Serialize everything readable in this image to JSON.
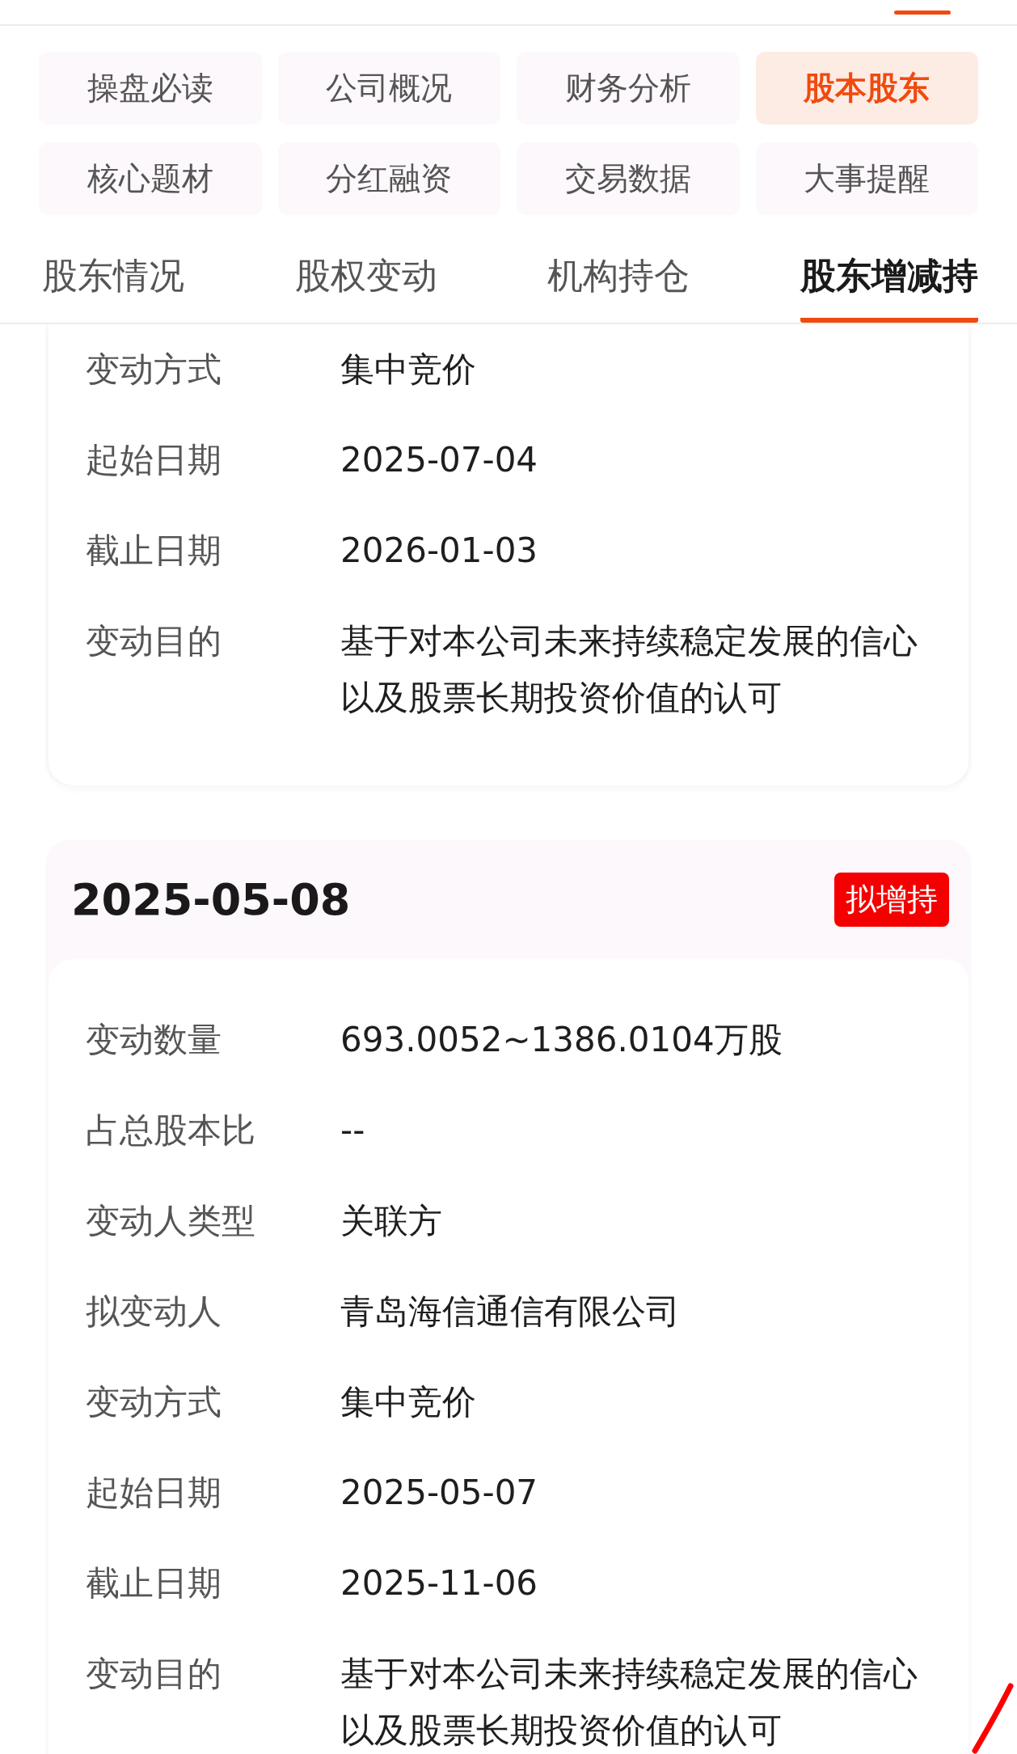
{
  "categories": [
    {
      "label": "操盘必读",
      "selected": false
    },
    {
      "label": "公司概况",
      "selected": false
    },
    {
      "label": "财务分析",
      "selected": false
    },
    {
      "label": "股本股东",
      "selected": true
    },
    {
      "label": "核心题材",
      "selected": false
    },
    {
      "label": "分红融资",
      "selected": false
    },
    {
      "label": "交易数据",
      "selected": false
    },
    {
      "label": "大事提醒",
      "selected": false
    }
  ],
  "subtabs": [
    {
      "label": "股东情况",
      "selected": false
    },
    {
      "label": "股权变动",
      "selected": false
    },
    {
      "label": "机构持仓",
      "selected": false
    },
    {
      "label": "股东增减持",
      "selected": true
    }
  ],
  "records": [
    {
      "rows": [
        {
          "label": "变动方式",
          "value": "集中竞价"
        },
        {
          "label": "起始日期",
          "value": "2025-07-04"
        },
        {
          "label": "截止日期",
          "value": "2026-01-03"
        },
        {
          "label": "变动目的",
          "value": "基于对本公司未来持续稳定发展的信心以及股票长期投资价值的认可"
        }
      ]
    },
    {
      "date": "2025-05-08",
      "badge": "拟增持",
      "rows": [
        {
          "label": "变动数量",
          "value": "693.0052~1386.0104万股"
        },
        {
          "label": "占总股本比",
          "value": "--"
        },
        {
          "label": "变动人类型",
          "value": "关联方"
        },
        {
          "label": "拟变动人",
          "value": "青岛海信通信有限公司"
        },
        {
          "label": "变动方式",
          "value": "集中竞价"
        },
        {
          "label": "起始日期",
          "value": "2025-05-07"
        },
        {
          "label": "截止日期",
          "value": "2025-11-06"
        },
        {
          "label": "变动目的",
          "value": "基于对本公司未来持续稳定发展的信心以及股票长期投资价值的认可"
        }
      ]
    }
  ]
}
